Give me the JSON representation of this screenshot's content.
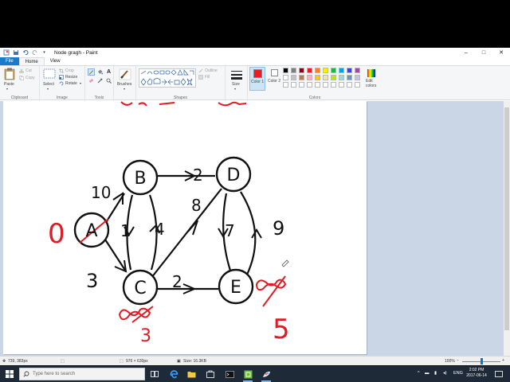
{
  "window": {
    "title": "Node gragh - Paint",
    "controls": {
      "minimize": "–",
      "maximize": "□",
      "close": "✕"
    }
  },
  "tabs": {
    "file": "File",
    "home": "Home",
    "view": "View"
  },
  "ribbon": {
    "clipboard": {
      "label": "Clipboard",
      "paste": "Paste",
      "cut": "Cut",
      "copy": "Copy"
    },
    "image": {
      "label": "Image",
      "select": "Select",
      "crop": "Crop",
      "resize": "Resize",
      "rotate": "Rotate"
    },
    "tools": {
      "label": "Tools"
    },
    "brushes": {
      "label": "Brushes"
    },
    "shapes": {
      "label": "Shapes",
      "outline": "Outline",
      "fill": "Fill"
    },
    "size": {
      "label": "Size"
    },
    "colors": {
      "label": "Colors",
      "color1": "Color 1",
      "color2": "Color 2",
      "edit": "Edit colors",
      "color1_value": "#ed1c24",
      "color2_value": "#ffffff",
      "palette_row1": [
        "#000000",
        "#7f7f7f",
        "#880015",
        "#ed1c24",
        "#ff7f27",
        "#fff200",
        "#22b14c",
        "#00a2e8",
        "#3f48cc",
        "#a349a4"
      ],
      "palette_row2": [
        "#ffffff",
        "#c3c3c3",
        "#b97a57",
        "#ffaec9",
        "#ffc90e",
        "#efe4b0",
        "#b5e61d",
        "#99d9ea",
        "#7092be",
        "#c8bfe7"
      ],
      "palette_row3": [
        "#ffffff",
        "#ffffff",
        "#ffffff",
        "#ffffff",
        "#ffffff",
        "#ffffff",
        "#ffffff",
        "#ffffff",
        "#ffffff",
        "#ffffff"
      ]
    }
  },
  "canvas": {
    "nodes": [
      "A",
      "B",
      "C",
      "D",
      "E"
    ],
    "edge_weights": [
      "10",
      "3",
      "1",
      "4",
      "2",
      "8",
      "2",
      "7",
      "9"
    ],
    "red_marks": [
      "0",
      "5",
      "3"
    ]
  },
  "status": {
    "cursor_pos": "739, 383px",
    "selection": "",
    "canvas_size": "976 × 630px",
    "file_size": "Size: 16.3KB",
    "zoom": "100%"
  },
  "taskbar": {
    "search_placeholder": "Type here to search",
    "lang": "ENG",
    "time": "2:02 PM",
    "date": "2017-06-14"
  }
}
